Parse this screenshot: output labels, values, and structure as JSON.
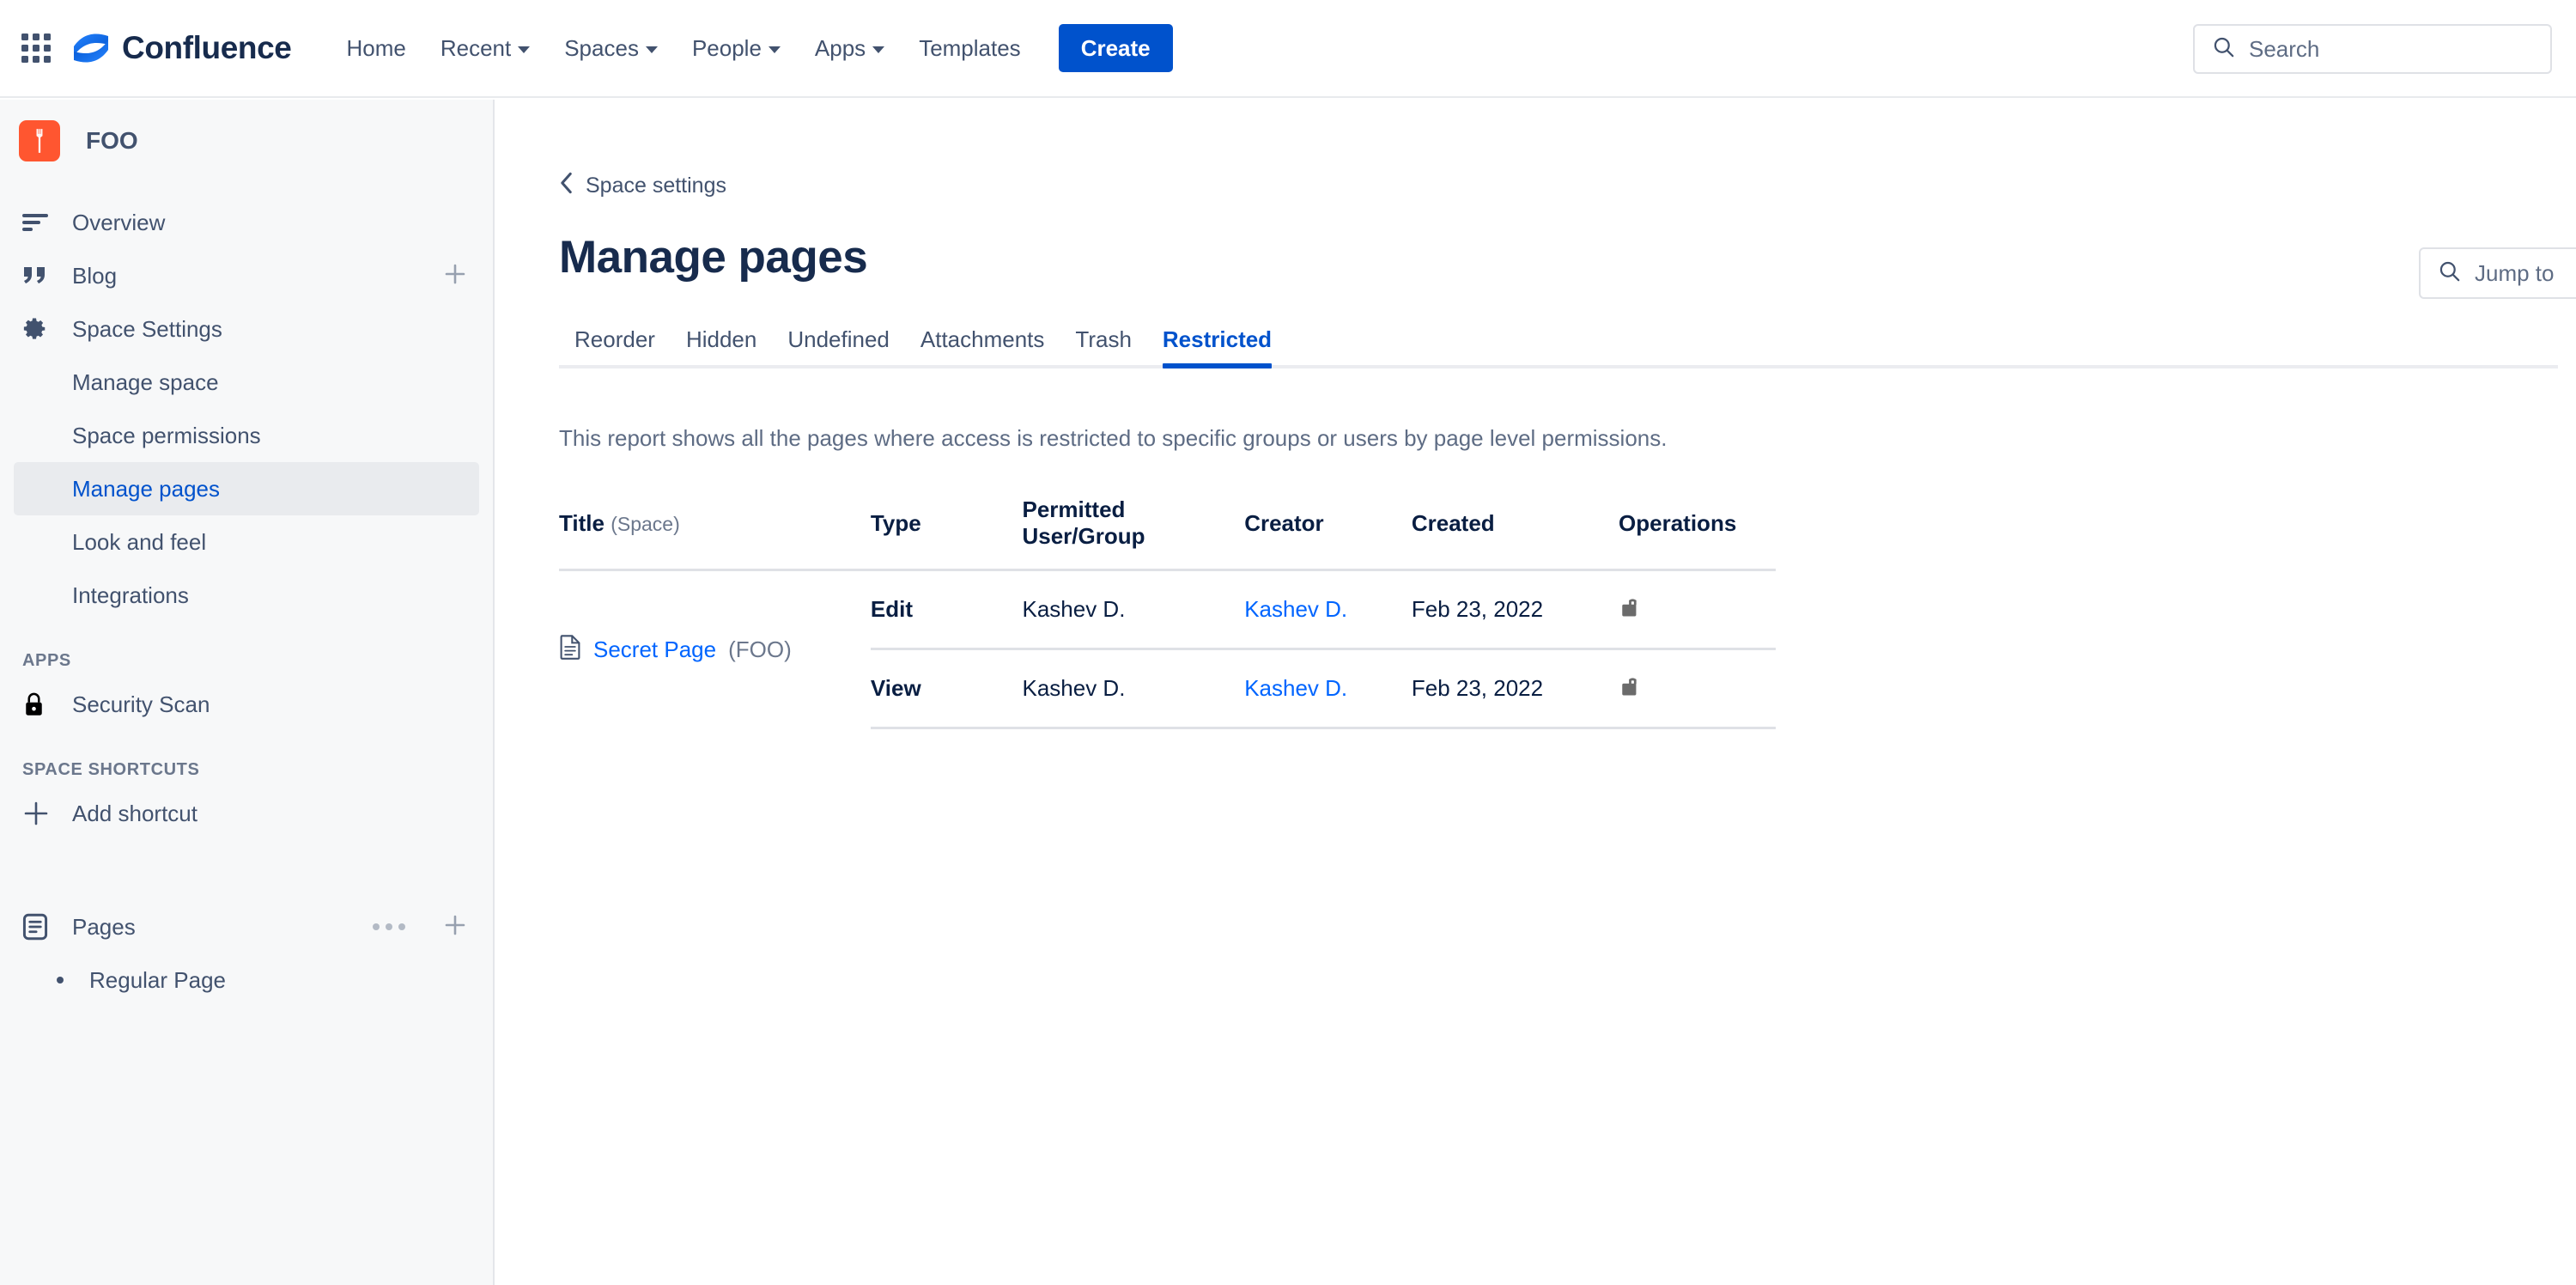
{
  "topnav": {
    "brand": "Confluence",
    "links": [
      {
        "label": "Home",
        "has_caret": false
      },
      {
        "label": "Recent",
        "has_caret": true
      },
      {
        "label": "Spaces",
        "has_caret": true
      },
      {
        "label": "People",
        "has_caret": true
      },
      {
        "label": "Apps",
        "has_caret": true
      },
      {
        "label": "Templates",
        "has_caret": false
      }
    ],
    "create_label": "Create",
    "search_placeholder": "Search"
  },
  "sidebar": {
    "space_name": "FOO",
    "nav": [
      {
        "label": "Overview"
      },
      {
        "label": "Blog"
      },
      {
        "label": "Space Settings"
      }
    ],
    "settings_children": [
      {
        "label": "Manage space"
      },
      {
        "label": "Space permissions"
      },
      {
        "label": "Manage pages"
      },
      {
        "label": "Look and feel"
      },
      {
        "label": "Integrations"
      }
    ],
    "apps_heading": "APPS",
    "apps": [
      {
        "label": "Security Scan"
      }
    ],
    "shortcuts_heading": "SPACE SHORTCUTS",
    "add_shortcut_label": "Add shortcut",
    "pages_label": "Pages",
    "page_tree": [
      {
        "label": "Regular Page"
      }
    ]
  },
  "main": {
    "back_label": "Space settings",
    "page_title": "Manage pages",
    "tabs": [
      {
        "label": "Reorder",
        "active": false
      },
      {
        "label": "Hidden",
        "active": false
      },
      {
        "label": "Undefined",
        "active": false
      },
      {
        "label": "Attachments",
        "active": false
      },
      {
        "label": "Trash",
        "active": false
      },
      {
        "label": "Restricted",
        "active": true
      }
    ],
    "description": "This report shows all the pages where access is restricted to specific groups or users by page level permissions.",
    "jump_to_placeholder": "Jump to"
  },
  "table": {
    "columns": {
      "title": "Title",
      "title_sub": "(Space)",
      "type": "Type",
      "permitted": "Permitted User/Group",
      "creator": "Creator",
      "created": "Created",
      "operations": "Operations"
    },
    "rows": [
      {
        "page_title": "Secret Page",
        "page_space": "(FOO)",
        "type": "Edit",
        "permitted": "Kashev D.",
        "creator": "Kashev D.",
        "created": "Feb 23, 2022",
        "operation_icon": "unlock-icon"
      },
      {
        "page_title": "",
        "page_space": "",
        "type": "View",
        "permitted": "Kashev D.",
        "creator": "Kashev D.",
        "created": "Feb 23, 2022",
        "operation_icon": "unlock-icon"
      }
    ]
  },
  "colors": {
    "brand_blue": "#0052cc",
    "link_blue": "#0065ff",
    "space_icon_red": "#ff5630",
    "text_navy": "#172b4d",
    "text_muted": "#6b778c",
    "sidebar_bg": "#f7f8f9",
    "selected_bg": "#e9ebee"
  }
}
